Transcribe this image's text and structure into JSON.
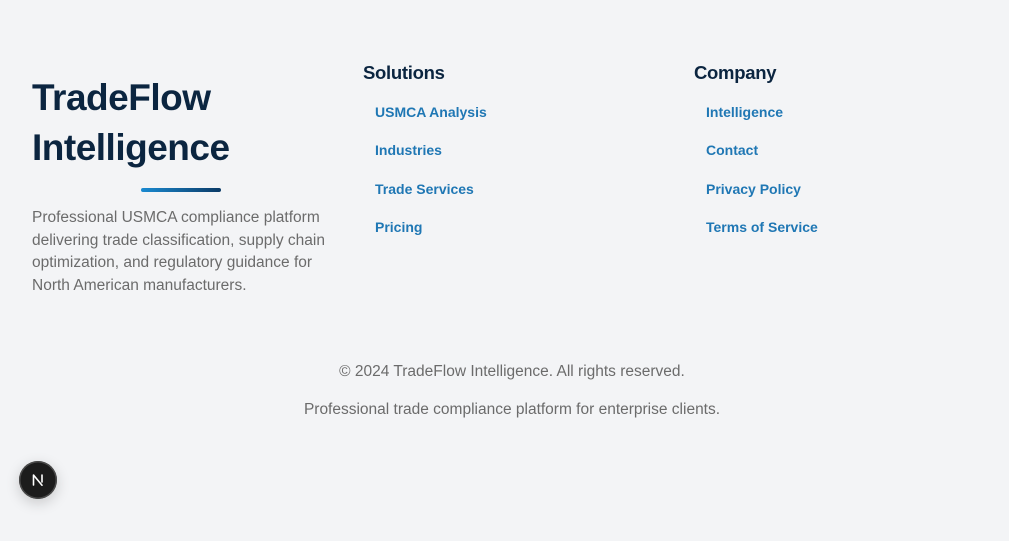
{
  "brand": {
    "title_line1": "TradeFlow",
    "title_line2": "Intelligence",
    "description": "Professional USMCA compliance platform delivering trade classification, supply chain optimization, and regulatory guidance for North American manufacturers."
  },
  "solutions": {
    "heading": "Solutions",
    "links": [
      "USMCA Analysis",
      "Industries",
      "Trade Services",
      "Pricing"
    ]
  },
  "company": {
    "heading": "Company",
    "links": [
      "Intelligence",
      "Contact",
      "Privacy Policy",
      "Terms of Service"
    ]
  },
  "bottom": {
    "copyright": "© 2024 TradeFlow Intelligence. All rights reserved.",
    "tagline": "Professional trade compliance platform for enterprise clients."
  },
  "dev_badge": {
    "icon": "nextjs-logo-icon",
    "letter": "N"
  },
  "colors": {
    "background": "#f3f4f6",
    "heading": "#0b2540",
    "link": "#1f77b4",
    "body_text": "#6b6b6b",
    "accent_start": "#1a8ad1",
    "accent_end": "#0b3a66"
  }
}
